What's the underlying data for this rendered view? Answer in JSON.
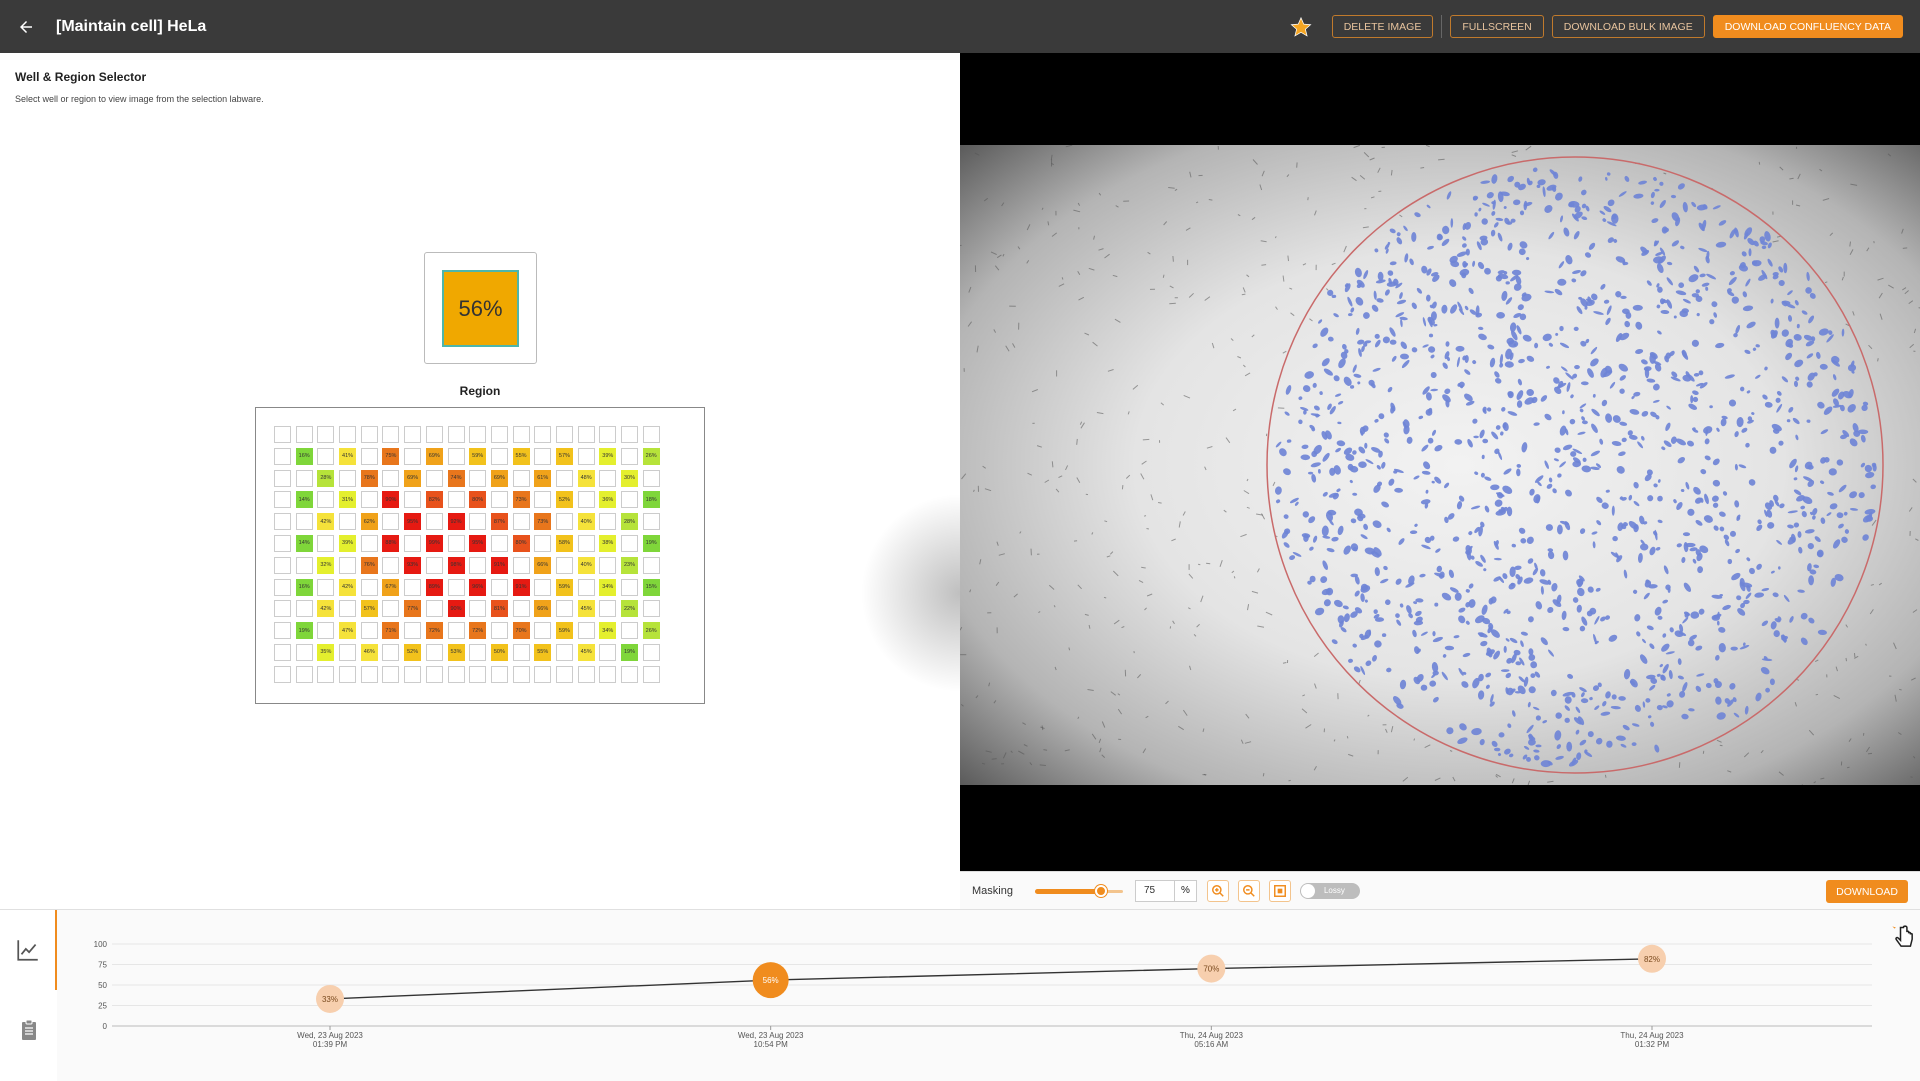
{
  "header": {
    "title": "[Maintain cell] HeLa",
    "back_icon": "arrow-left-icon",
    "star_icon": "star-icon",
    "buttons": {
      "delete_image": "DELETE IMAGE",
      "fullscreen": "FULLSCREEN",
      "download_bulk": "DOWNLOAD BULK IMAGE",
      "download_confluency": "DOWNLOAD CONFLUENCY DATA"
    }
  },
  "selector": {
    "title": "Well & Region Selector",
    "subtitle": "Select well or region to view image from the selection labware.",
    "selected_well_value": "56%",
    "region_label": "Region"
  },
  "plate": {
    "columns": 18,
    "rows": [
      [
        "",
        "",
        "",
        "",
        "",
        "",
        "",
        "",
        "",
        "",
        "",
        "",
        "",
        "",
        "",
        "",
        "",
        ""
      ],
      [
        "",
        "16%",
        "",
        "41%",
        "",
        "75%",
        "",
        "69%",
        "",
        "59%",
        "",
        "55%",
        "",
        "57%",
        "",
        "39%",
        "",
        "26%"
      ],
      [
        "",
        "",
        "28%",
        "",
        "78%",
        "",
        "69%",
        "",
        "74%",
        "",
        "69%",
        "",
        "61%",
        "",
        "48%",
        "",
        "30%",
        ""
      ],
      [
        "",
        "14%",
        "",
        "31%",
        "",
        "90%",
        "",
        "82%",
        "",
        "80%",
        "",
        "73%",
        "",
        "52%",
        "",
        "36%",
        "",
        "18%"
      ],
      [
        "",
        "",
        "42%",
        "",
        "62%",
        "",
        "95%",
        "",
        "92%",
        "",
        "87%",
        "",
        "73%",
        "",
        "40%",
        "",
        "28%",
        ""
      ],
      [
        "",
        "14%",
        "",
        "39%",
        "",
        "88%",
        "",
        "99%",
        "",
        "95%",
        "",
        "80%",
        "",
        "58%",
        "",
        "38%",
        "",
        "19%"
      ],
      [
        "",
        "",
        "32%",
        "",
        "76%",
        "",
        "93%",
        "",
        "98%",
        "",
        "91%",
        "",
        "66%",
        "",
        "40%",
        "",
        "23%",
        ""
      ],
      [
        "",
        "16%",
        "",
        "42%",
        "",
        "67%",
        "",
        "89%",
        "",
        "96%",
        "",
        "91%",
        "",
        "59%",
        "",
        "34%",
        "",
        "15%"
      ],
      [
        "",
        "",
        "42%",
        "",
        "57%",
        "",
        "77%",
        "",
        "90%",
        "",
        "81%",
        "",
        "66%",
        "",
        "45%",
        "",
        "22%",
        ""
      ],
      [
        "",
        "19%",
        "",
        "47%",
        "",
        "71%",
        "",
        "72%",
        "",
        "72%",
        "",
        "70%",
        "",
        "59%",
        "",
        "34%",
        "",
        "26%"
      ],
      [
        "",
        "",
        "35%",
        "",
        "46%",
        "",
        "52%",
        "",
        "53%",
        "",
        "50%",
        "",
        "55%",
        "",
        "45%",
        "",
        "19%",
        ""
      ],
      [
        "",
        "",
        "",
        "",
        "",
        "",
        "",
        "",
        "",
        "",
        "",
        "",
        "",
        "",
        "",
        "",
        "",
        ""
      ]
    ]
  },
  "viewer": {
    "masking_label": "Masking",
    "masking_value": "75",
    "masking_fraction": 0.75,
    "unit": "%",
    "zoom_in_icon": "zoom-in-icon",
    "zoom_out_icon": "zoom-out-icon",
    "fit_icon": "fit-screen-icon",
    "lossy_label": "Lossy",
    "download_label": "DOWNLOAD"
  },
  "side_rail": {
    "items": [
      {
        "icon": "line-chart-icon",
        "active": true
      },
      {
        "icon": "clipboard-icon",
        "active": false
      }
    ]
  },
  "chart_data": {
    "type": "line",
    "y_ticks": [
      "100",
      "75",
      "50",
      "25",
      "0"
    ],
    "ylim": [
      0,
      100
    ],
    "points": [
      {
        "label": "33%",
        "value": 33,
        "date": "Wed, 23 Aug 2023",
        "time": "01:39 PM",
        "selected": false
      },
      {
        "label": "56%",
        "value": 56,
        "date": "Wed, 23 Aug 2023",
        "time": "10:54 PM",
        "selected": true
      },
      {
        "label": "70%",
        "value": 70,
        "date": "Thu, 24 Aug 2023",
        "time": "05:16 AM",
        "selected": false
      },
      {
        "label": "82%",
        "value": 82,
        "date": "Thu, 24 Aug 2023",
        "time": "01:32 PM",
        "selected": false
      }
    ],
    "colors": {
      "accent": "#f08c1e",
      "point": "#f7cfae",
      "line": "#333333"
    }
  },
  "colors": {
    "accent": "#f08c1e",
    "header_bg": "#3a3a3a",
    "mask_blue": "#6f84d6",
    "roi_circle": "#c96a6a"
  }
}
